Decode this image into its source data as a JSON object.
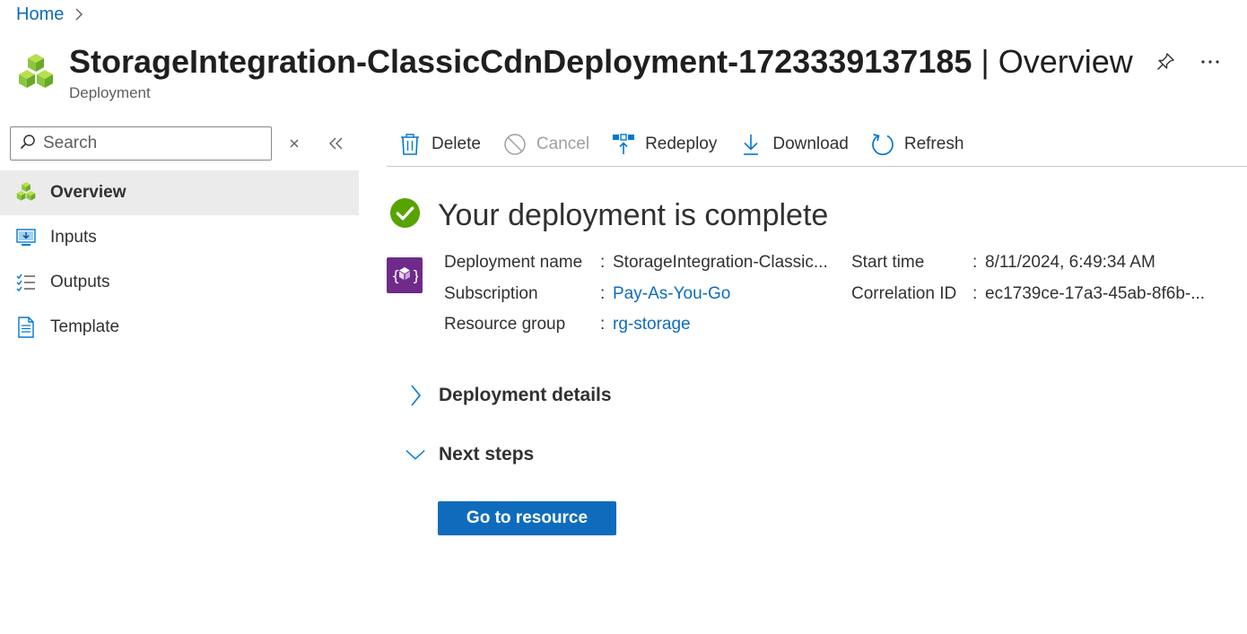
{
  "breadcrumb": {
    "home": "Home"
  },
  "header": {
    "title_main": "StorageIntegration-ClassicCdnDeployment-1723339137185",
    "title_sep": " | ",
    "title_section": "Overview",
    "subtitle": "Deployment",
    "icons": {
      "resource": "deployment-cubes-icon",
      "pin": "pin-icon",
      "more": "more-icon"
    }
  },
  "sidebar": {
    "search_placeholder": "Search",
    "items": [
      {
        "label": "Overview",
        "icon": "deployment-cubes-icon",
        "active": true
      },
      {
        "label": "Inputs",
        "icon": "inputs-icon"
      },
      {
        "label": "Outputs",
        "icon": "outputs-list-icon"
      },
      {
        "label": "Template",
        "icon": "template-document-icon"
      }
    ]
  },
  "toolbar": {
    "delete": "Delete",
    "cancel": "Cancel",
    "redeploy": "Redeploy",
    "download": "Download",
    "refresh": "Refresh"
  },
  "status": {
    "title": "Your deployment is complete",
    "icon": "success-check-icon",
    "color": "#57a300"
  },
  "details": {
    "deployment_name_label": "Deployment name",
    "deployment_name_value": "StorageIntegration-Classic...",
    "subscription_label": "Subscription",
    "subscription_value": "Pay-As-You-Go",
    "resource_group_label": "Resource group",
    "resource_group_value": "rg-storage",
    "start_time_label": "Start time",
    "start_time_value": "8/11/2024, 6:49:34 AM",
    "correlation_id_label": "Correlation ID",
    "correlation_id_value": "ec1739ce-17a3-45ab-8f6b-...",
    "separator": ":"
  },
  "sections": {
    "deployment_details": "Deployment details",
    "next_steps": "Next steps"
  },
  "actions": {
    "go_to_resource": "Go to resource"
  },
  "colors": {
    "accent": "#0f6cbd",
    "deploy_icon_bg": "#6e2b89",
    "active_nav_bg": "#ebebeb"
  }
}
